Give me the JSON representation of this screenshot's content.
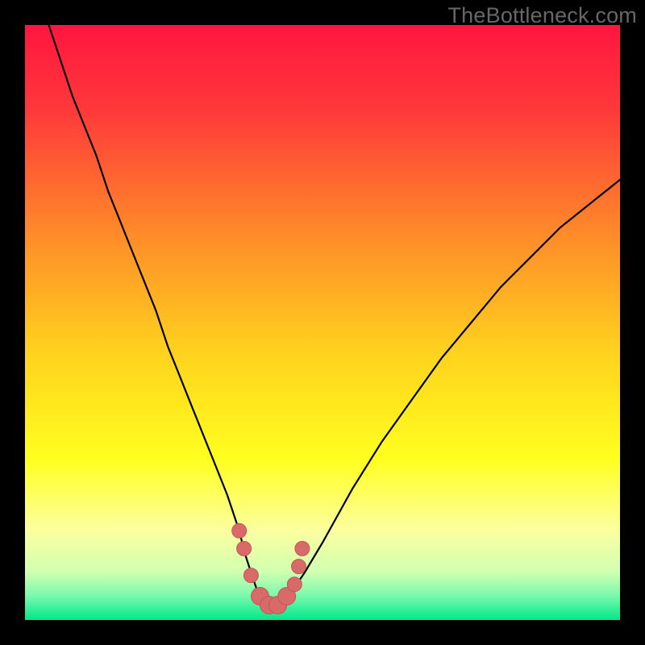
{
  "watermark": {
    "text": "TheBottleneck.com"
  },
  "colors": {
    "frame": "#000000",
    "gradient_stops": [
      {
        "pct": 0,
        "color": "#ff153f"
      },
      {
        "pct": 15,
        "color": "#ff3b3a"
      },
      {
        "pct": 35,
        "color": "#ff8a29"
      },
      {
        "pct": 55,
        "color": "#ffd21e"
      },
      {
        "pct": 73,
        "color": "#ffff1f"
      },
      {
        "pct": 85,
        "color": "#fcffa0"
      },
      {
        "pct": 92,
        "color": "#d0ffb0"
      },
      {
        "pct": 96,
        "color": "#77f9ad"
      },
      {
        "pct": 100,
        "color": "#00e88c"
      }
    ],
    "curve_stroke": "#000000",
    "marker_fill": "#d86a6a",
    "marker_stroke": "#c35757"
  },
  "chart_data": {
    "type": "line",
    "title": "",
    "xlabel": "",
    "ylabel": "",
    "xlim": [
      0,
      100
    ],
    "ylim": [
      0,
      100
    ],
    "grid": false,
    "legend": false,
    "series": [
      {
        "name": "bottleneck-curve",
        "x": [
          4,
          6,
          8,
          10,
          12,
          14,
          16,
          18,
          20,
          22,
          24,
          26,
          28,
          30,
          32,
          34,
          36,
          37,
          38,
          39,
          40,
          41,
          42,
          43,
          44,
          45,
          47,
          50,
          55,
          60,
          65,
          70,
          75,
          80,
          85,
          90,
          95,
          100
        ],
        "y": [
          100,
          94,
          88,
          83,
          78,
          72,
          67,
          62,
          57,
          52,
          46,
          41,
          36,
          31,
          26,
          21,
          15,
          11,
          8,
          5,
          3,
          2,
          2,
          2,
          3,
          5,
          8,
          13,
          22,
          30,
          37,
          44,
          50,
          56,
          61,
          66,
          70,
          74
        ]
      }
    ],
    "markers": {
      "name": "highlight-dots",
      "x": [
        36.0,
        36.8,
        38.0,
        39.5,
        41.0,
        42.5,
        44.0,
        45.3,
        46.0,
        46.6
      ],
      "y": [
        15.0,
        12.0,
        7.5,
        4.0,
        2.5,
        2.5,
        4.0,
        6.0,
        9.0,
        12.0
      ],
      "r": [
        9,
        9,
        9,
        11,
        11,
        11,
        11,
        9,
        9,
        9
      ]
    }
  }
}
